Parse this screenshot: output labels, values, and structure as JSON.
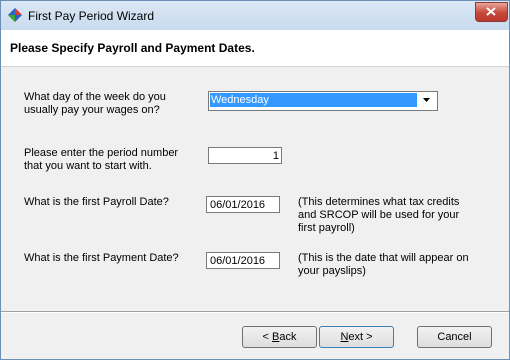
{
  "window": {
    "title": "First Pay Period Wizard"
  },
  "header": {
    "heading": "Please Specify Payroll and Payment Dates."
  },
  "form": {
    "pay_day": {
      "label": "What day of the week do you usually pay your wages on?",
      "value": "Wednesday"
    },
    "period": {
      "label_line1": "Please enter the period number",
      "label_line2": "that you want to start with.",
      "value": "1"
    },
    "payroll_date": {
      "label": "What is the first Payroll Date?",
      "value": "06/01/2016",
      "note_line1": "(This determines what tax credits",
      "note_line2": "and SRCOP will be used for your",
      "note_line3": "first payroll)"
    },
    "payment_date": {
      "label": "What is the first Payment Date?",
      "value": "06/01/2016",
      "note_line1": "(This is the date that will appear on",
      "note_line2": "your payslips)"
    }
  },
  "buttons": {
    "back": {
      "prefix": "< ",
      "mnemonic": "B",
      "rest": "ack"
    },
    "next": {
      "mnemonic": "N",
      "rest": "ext >"
    },
    "cancel": "Cancel"
  },
  "icons": {
    "app": "wizard-app-icon",
    "close": "close-icon",
    "dropdown": "chevron-down-icon"
  },
  "colors": {
    "selection": "#3399ff",
    "titlebar": "#c9dbee",
    "close": "#c7483a"
  }
}
